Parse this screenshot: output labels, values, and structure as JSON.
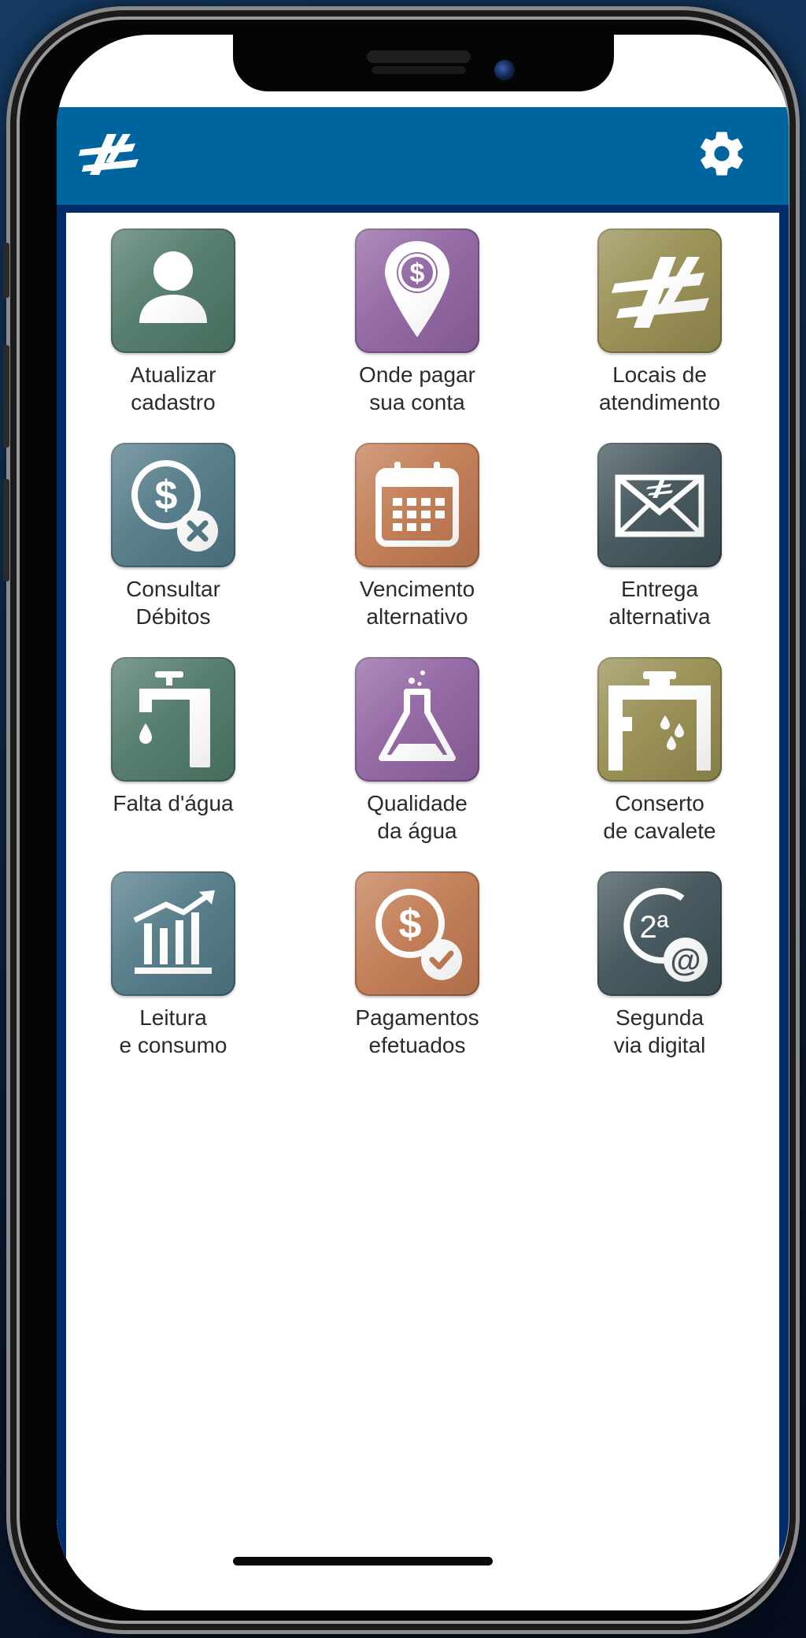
{
  "header": {
    "logo_icon": "brand-logo-icon",
    "settings_icon": "gear-icon",
    "color": "#00649f"
  },
  "menu": {
    "items": [
      {
        "line1": "Atualizar",
        "line2": "cadastro",
        "icon": "person-icon",
        "color": "#4d7766"
      },
      {
        "line1": "Onde pagar",
        "line2": "sua conta",
        "icon": "map-pin-dollar-icon",
        "color": "#8f62a0"
      },
      {
        "line1": "Locais de",
        "line2": "atendimento",
        "icon": "brand-logo-icon",
        "color": "#958c4f"
      },
      {
        "line1": "Consultar",
        "line2": "Débitos",
        "icon": "dollar-cancel-icon",
        "color": "#4f7885"
      },
      {
        "line1": "Vencimento",
        "line2": "alternativo",
        "icon": "calendar-icon",
        "color": "#c07950"
      },
      {
        "line1": "Entrega",
        "line2": "alternativa",
        "icon": "envelope-icon",
        "color": "#3e5157"
      },
      {
        "line1": "Falta d'água",
        "line2": "",
        "icon": "faucet-icon",
        "color": "#4d7766"
      },
      {
        "line1": "Qualidade",
        "line2": "da água",
        "icon": "flask-icon",
        "color": "#8f62a0"
      },
      {
        "line1": "Conserto",
        "line2": "de cavalete",
        "icon": "pipe-leak-icon",
        "color": "#958c4f"
      },
      {
        "line1": "Leitura",
        "line2": "e consumo",
        "icon": "bar-chart-icon",
        "color": "#4f7885"
      },
      {
        "line1": "Pagamentos",
        "line2": "efetuados",
        "icon": "dollar-check-icon",
        "color": "#c07950"
      },
      {
        "line1": "Segunda",
        "line2": "via digital",
        "icon": "second-copy-email-icon",
        "color": "#3e5157"
      }
    ]
  },
  "icon_texts": {
    "second_copy": "2ª"
  }
}
